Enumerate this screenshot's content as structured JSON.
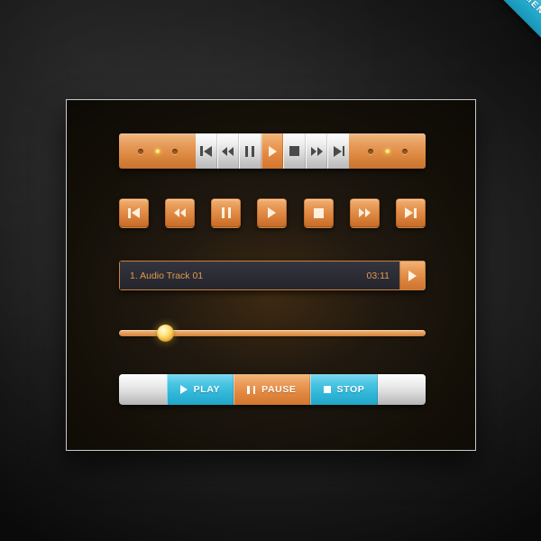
{
  "ribbon": {
    "label": "AUDIO WEB ELEMENTS",
    "color": "#32b5d6"
  },
  "theme": {
    "orange": "#e0873f",
    "cyan": "#2fb6d8",
    "silver": "#dcdcdc",
    "panel_bg": "#1d1710",
    "text_orange": "#e09a4a"
  },
  "toolbar": {
    "name": "combined-transport-bar",
    "left_leds": [
      {
        "name": "led-1",
        "state": "off"
      },
      {
        "name": "led-2",
        "state": "on"
      },
      {
        "name": "led-3",
        "state": "off"
      }
    ],
    "right_leds": [
      {
        "name": "led-4",
        "state": "off"
      },
      {
        "name": "led-5",
        "state": "on"
      },
      {
        "name": "led-6",
        "state": "off"
      }
    ],
    "buttons": [
      {
        "icon": "previous-track-icon",
        "label": "Previous Track",
        "active": false
      },
      {
        "icon": "rewind-icon",
        "label": "Rewind",
        "active": false
      },
      {
        "icon": "pause-icon",
        "label": "Pause",
        "active": false
      },
      {
        "icon": "play-icon",
        "label": "Play",
        "active": true
      },
      {
        "icon": "stop-icon",
        "label": "Stop",
        "active": false
      },
      {
        "icon": "fast-forward-icon",
        "label": "Fast Forward",
        "active": false
      },
      {
        "icon": "next-track-icon",
        "label": "Next Track",
        "active": false
      }
    ]
  },
  "button_row": {
    "name": "standalone-transport-buttons",
    "buttons": [
      {
        "icon": "previous-track-icon",
        "label": "Previous Track"
      },
      {
        "icon": "rewind-icon",
        "label": "Rewind"
      },
      {
        "icon": "pause-icon",
        "label": "Pause"
      },
      {
        "icon": "play-icon",
        "label": "Play"
      },
      {
        "icon": "stop-icon",
        "label": "Stop"
      },
      {
        "icon": "fast-forward-icon",
        "label": "Fast Forward"
      },
      {
        "icon": "next-track-icon",
        "label": "Next Track"
      }
    ]
  },
  "track": {
    "title": "1. Audio Track 01",
    "duration": "03:11",
    "play_icon": "play-icon"
  },
  "slider": {
    "name": "progress-slider",
    "value_percent": 15,
    "min": 0,
    "max": 100
  },
  "bottom_bar": {
    "buttons": [
      {
        "label": "PLAY",
        "icon": "play-icon",
        "style": "cyan"
      },
      {
        "label": "PAUSE",
        "icon": "pause-icon",
        "style": "orange"
      },
      {
        "label": "STOP",
        "icon": "stop-icon",
        "style": "cyan"
      }
    ]
  }
}
